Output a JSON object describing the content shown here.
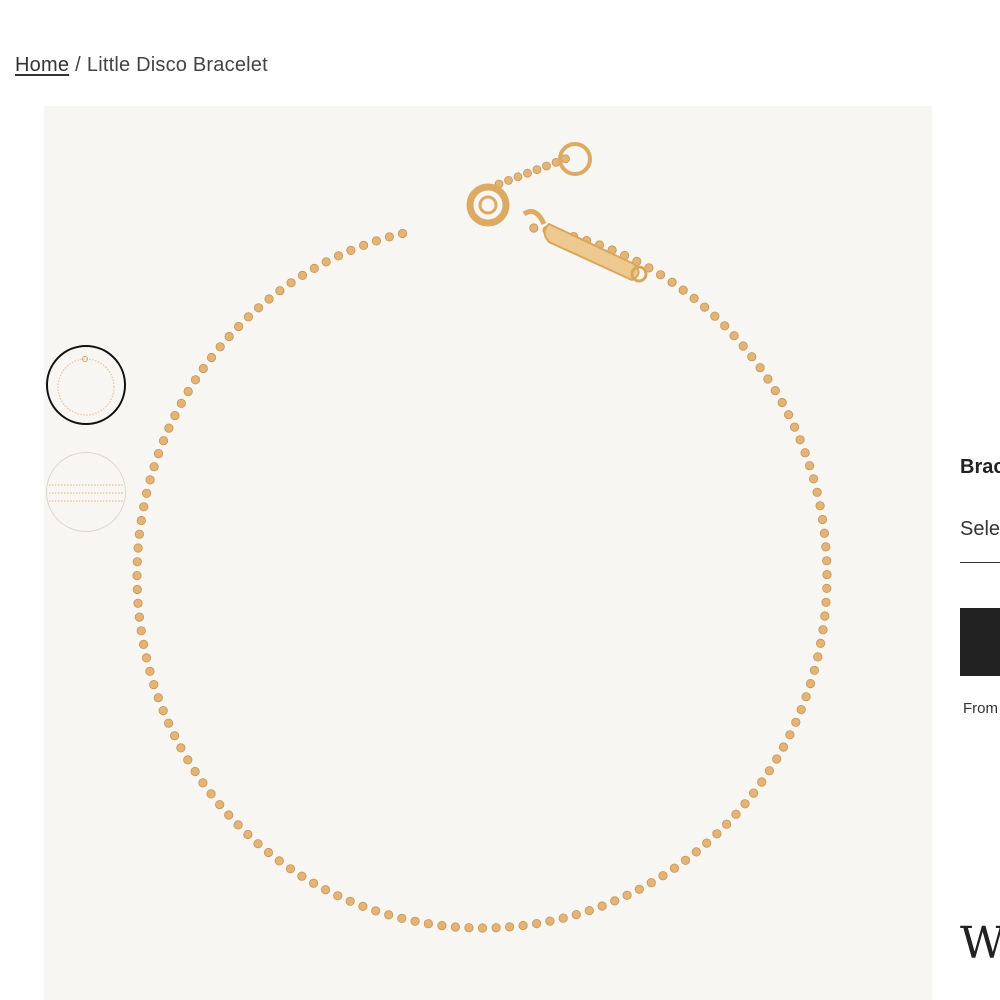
{
  "breadcrumb": {
    "home": "Home",
    "separator": "/",
    "current": "Little Disco Bracelet"
  },
  "gallery": {
    "background": "#f8f6f3",
    "chain_color": "#e2b477",
    "thumbnails": [
      "bracelet-full-view",
      "bracelet-stacked-view"
    ]
  },
  "sidebar": {
    "variant_label": "Brac",
    "select_text": "Sele",
    "price_note": "From",
    "heading_letter": "W"
  }
}
